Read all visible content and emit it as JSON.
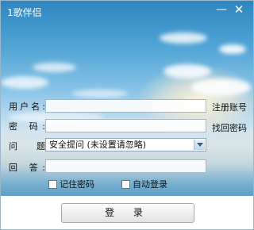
{
  "window": {
    "title": "1歌伴侣",
    "minimize_glyph": "—",
    "close_glyph": "✕"
  },
  "form": {
    "username_label": "用户名:",
    "password_label": "密  码:",
    "question_label": "问  题",
    "answer_label": "回  答:",
    "username_value": "",
    "password_value": "",
    "question_selected": "安全提问 (未设置请忽略)",
    "answer_value": ""
  },
  "links": {
    "register": "注册账号",
    "find_password": "找回密码"
  },
  "options": {
    "remember_password": "记住密码",
    "auto_login": "自动登录",
    "remember_checked": false,
    "auto_checked": false
  },
  "actions": {
    "login": "登 录"
  },
  "colors": {
    "sky_top": "#2f85bf",
    "sea": "#5c9fc8",
    "field_border": "#aab6c0"
  },
  "icons": {
    "minimize": "minimize-icon",
    "close": "close-icon",
    "dropdown": "chevron-down-icon"
  }
}
